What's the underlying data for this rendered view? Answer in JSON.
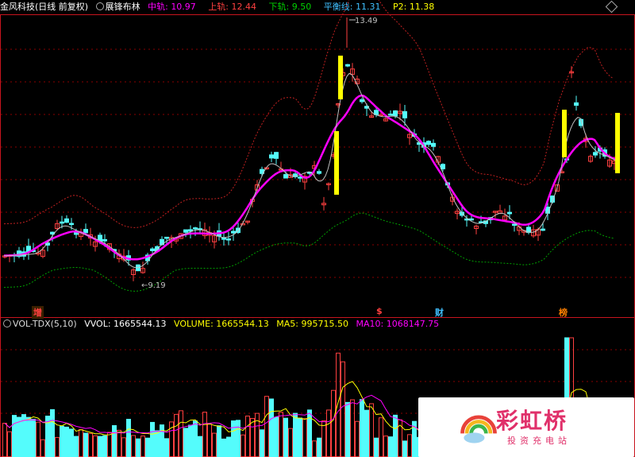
{
  "main_header": {
    "title": "金风科技",
    "period": "(日线 前复权)",
    "indicator_icon": "circle-icon",
    "indicator_name": "展锋布林",
    "mid_label": "中轨:",
    "mid_value": "10.97",
    "upper_label": "上轨:",
    "upper_value": "12.44",
    "lower_label": "下轨:",
    "lower_value": "9.50",
    "balance_label": "平衡线:",
    "balance_value": "11.31",
    "p2_label": "P2:",
    "p2_value": "11.38",
    "colors": {
      "mid": "#ff00ff",
      "upper": "#ff4040",
      "lower": "#00c000",
      "balance": "#40c0ff",
      "p2": "#ffff00"
    }
  },
  "price_annotations": {
    "high": "13.49",
    "low": "9.19"
  },
  "badges": [
    {
      "text": "增",
      "color": "#ff4040"
    },
    {
      "text": "$",
      "color": "#ff4040"
    },
    {
      "text": "财",
      "color": "#40c0ff"
    },
    {
      "text": "榜",
      "color": "#ff8000"
    }
  ],
  "vol_header": {
    "indicator_icon": "circle-icon",
    "name": "VOL-TDX(5,10)",
    "vvol": "VVOL: 1665544.13",
    "volume": "VOLUME: 1665544.13",
    "ma5": "MA5: 995715.50",
    "ma10": "MA10: 1068147.75",
    "colors": {
      "volume": "#ffff00",
      "ma5": "#ffff00",
      "ma10": "#ff00ff"
    }
  },
  "watermark": {
    "name": "彩虹桥",
    "sub": "投资充电站"
  },
  "colors": {
    "up": "#ff4040",
    "down": "#54fcfc",
    "grid": "#8a0000",
    "mid_band": "#ff00ff",
    "upper_band": "#c02020",
    "lower_band": "#00a000",
    "ma": "#c0c0c0",
    "signal": "#ffff00"
  }
}
